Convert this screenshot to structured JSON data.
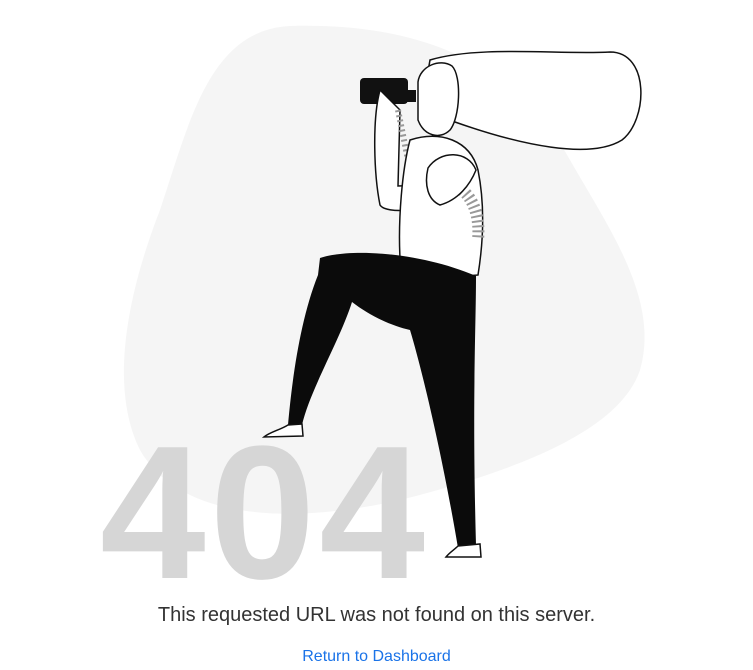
{
  "error": {
    "code": "404",
    "message": "This requested URL was not found on this server.",
    "action_label": "Return to Dashboard"
  },
  "colors": {
    "background": "#ffffff",
    "blob": "#f5f5f5",
    "code": "#d6d6d6",
    "text": "#333333",
    "link": "#1a73e8"
  },
  "illustration": {
    "icon": "person-with-binoculars-illustration"
  }
}
